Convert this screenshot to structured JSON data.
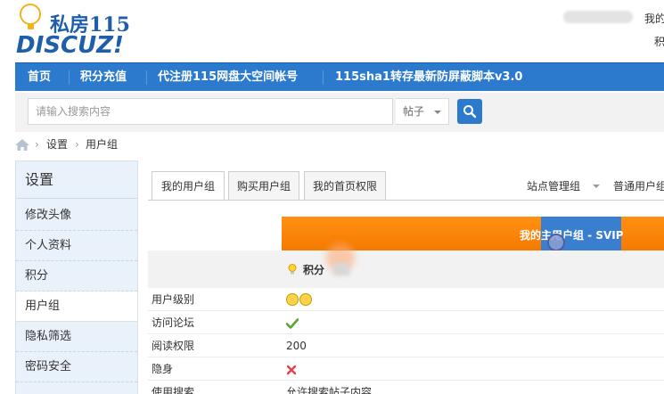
{
  "header": {
    "site_name": "私房115",
    "brand": "DISCUZ!",
    "user_link_top": "我的",
    "user_link_bottom": "积"
  },
  "nav": {
    "items": [
      "首页",
      "积分充值",
      "代注册115网盘大空间帐号",
      "115sha1转存最新防屏蔽脚本v3.0"
    ]
  },
  "search": {
    "placeholder": "请输入搜索内容",
    "type": "帖子"
  },
  "breadcrumb": {
    "items": [
      "设置",
      "用户组"
    ]
  },
  "sidebar": {
    "title": "设置",
    "items": [
      "修改头像",
      "个人资料",
      "积分",
      "用户组",
      "隐私筛选",
      "密码安全"
    ]
  },
  "tabs": [
    "我的用户组",
    "购买用户组",
    "我的首页权限"
  ],
  "group_select": [
    "站点管理组",
    "普通用户组"
  ],
  "table": {
    "main_group": "我的主用户组 - SVIP",
    "points_label": "积分",
    "rows": [
      {
        "key": "用户级别",
        "value": ""
      },
      {
        "key": "访问论坛",
        "value": ""
      },
      {
        "key": "阅读权限",
        "value": "200"
      },
      {
        "key": "隐身",
        "value": ""
      },
      {
        "key": "使用搜索",
        "value": "允许搜索帖子内容"
      }
    ]
  },
  "colors": {
    "nav_blue": "#2b7acd",
    "orange": "#f47a00",
    "check_green": "#5aa52b",
    "cross_red": "#e2424c"
  }
}
